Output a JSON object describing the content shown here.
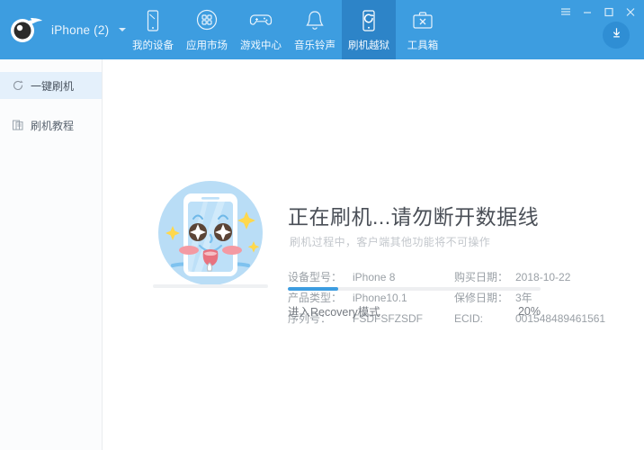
{
  "window": {
    "menu_icon": "hamburger-menu-icon",
    "minimize_icon": "minimize-icon",
    "maximize_icon": "maximize-icon",
    "close_icon": "close-icon",
    "download_icon": "download-icon",
    "header_color": "#3d9de0",
    "active_tab_color": "#2d84c8"
  },
  "brand": {
    "logo_icon": "pp-assistant-logo-icon",
    "device_label": "iPhone (2)",
    "dropdown_icon": "chevron-down-icon"
  },
  "nav": {
    "items": [
      {
        "label": "我的设备",
        "icon": "phone-icon",
        "active": false
      },
      {
        "label": "应用市场",
        "icon": "appstore-icon",
        "active": false
      },
      {
        "label": "游戏中心",
        "icon": "gamepad-icon",
        "active": false
      },
      {
        "label": "音乐铃声",
        "icon": "bell-icon",
        "active": false
      },
      {
        "label": "刷机越狱",
        "icon": "flash-phone-icon",
        "active": true
      },
      {
        "label": "工具箱",
        "icon": "toolbox-icon",
        "active": false
      }
    ]
  },
  "sidebar": {
    "items": [
      {
        "label": "一键刷机",
        "icon": "refresh-circle-icon",
        "active": true
      },
      {
        "label": "刷机教程",
        "icon": "document-copy-icon",
        "active": false
      }
    ]
  },
  "main": {
    "title": "正在刷机...请勿断开数据线",
    "subtitle": "刷机过程中，客户端其他功能将不可操作",
    "illustration_icon": "happy-phone-character-illustration",
    "info": [
      [
        {
          "key": "设备型号：",
          "value": "iPhone 8"
        },
        {
          "key": "购买日期：",
          "value": "2018-10-22"
        }
      ],
      [
        {
          "key": "产品类型：",
          "value": "iPhone10.1"
        },
        {
          "key": "保修日期：",
          "value": "3年"
        }
      ],
      [
        {
          "key": "序列号：",
          "value": "FSDFSFZSDF"
        },
        {
          "key": "ECID:",
          "value": "001548489461561"
        }
      ]
    ],
    "progress": {
      "label": "进入Recovery模式",
      "percent_text": "20%",
      "percent_value": 20,
      "bar_color": "#3d9de0"
    }
  }
}
